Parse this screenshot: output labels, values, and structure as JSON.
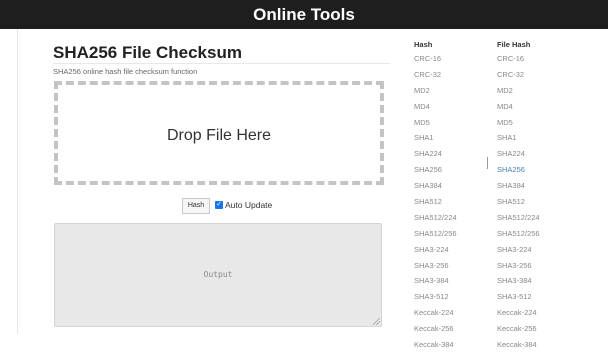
{
  "header": {
    "title": "Online Tools"
  },
  "main": {
    "title": "SHA256 File Checksum",
    "subtitle": "SHA256 online hash file checksum function",
    "dropzone_label": "Drop File Here",
    "hash_button": "Hash",
    "auto_update": {
      "label": "Auto Update",
      "checked": true
    },
    "output_placeholder": "Output"
  },
  "sidebar": {
    "hash_heading": "Hash",
    "file_hash_heading": "File Hash",
    "hash_items": [
      "CRC-16",
      "CRC-32",
      "MD2",
      "MD4",
      "MD5",
      "SHA1",
      "SHA224",
      "SHA256",
      "SHA384",
      "SHA512",
      "SHA512/224",
      "SHA512/256",
      "SHA3-224",
      "SHA3-256",
      "SHA3-384",
      "SHA3-512",
      "Keccak-224",
      "Keccak-256",
      "Keccak-384"
    ],
    "file_hash_items": [
      "CRC-16",
      "CRC-32",
      "MD2",
      "MD4",
      "MD5",
      "SHA1",
      "SHA224",
      "SHA256",
      "SHA384",
      "SHA512",
      "SHA512/224",
      "SHA512/256",
      "SHA3-224",
      "SHA3-256",
      "SHA3-384",
      "SHA3-512",
      "Keccak-224",
      "Keccak-256",
      "Keccak-384"
    ],
    "active_file_hash": "SHA256"
  },
  "colors": {
    "topbar": "#1e1e1e",
    "link": "#888888",
    "active_link": "#4a7fb5",
    "checkbox": "#1a73e8"
  }
}
